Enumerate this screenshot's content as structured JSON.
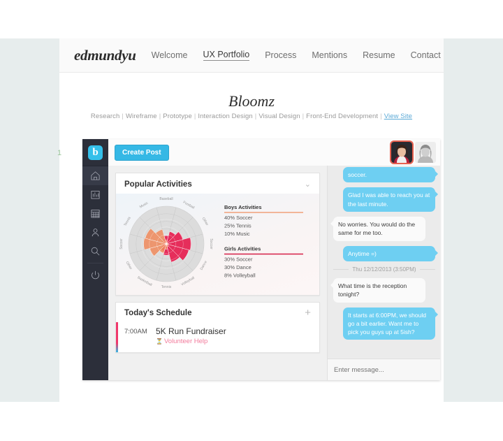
{
  "nav": {
    "logo": "edmundyu",
    "links": [
      {
        "label": "Welcome",
        "active": false
      },
      {
        "label": "UX Portfolio",
        "active": true
      },
      {
        "label": "Process",
        "active": false
      },
      {
        "label": "Mentions",
        "active": false
      },
      {
        "label": "Resume",
        "active": false
      },
      {
        "label": "Contact",
        "active": false
      }
    ]
  },
  "project": {
    "title": "Bloomz",
    "tags": [
      "Research",
      "Wireframe",
      "Prototype",
      "Interaction Design",
      "Visual Design",
      "Front-End Development"
    ],
    "link_label": "View Site",
    "marker": "1"
  },
  "app": {
    "brand_letter": "b",
    "sidebar_icons": [
      "home-icon",
      "bar-chart-icon",
      "calendar-icon",
      "person-icon",
      "search-icon",
      "power-icon"
    ],
    "topbar": {
      "create_post": "Create Post"
    },
    "activities_card": {
      "title": "Popular Activities",
      "collapse_icon": "chevron-down-icon"
    },
    "schedule_card": {
      "title": "Today's Schedule",
      "add_icon": "plus-icon",
      "events": [
        {
          "time": "7:00AM",
          "title": "5K Run Fundraiser",
          "sub": "Volunteer Help"
        }
      ]
    },
    "chat": {
      "messages": [
        {
          "from": "me",
          "text": "soccer.",
          "clipped": true
        },
        {
          "from": "me",
          "text": "Glad I was able to reach you at the last minute."
        },
        {
          "from": "them",
          "text": "No worries.  You would do the same for me too."
        },
        {
          "from": "me",
          "text": "Anytime =)"
        },
        {
          "from": "divider",
          "text": "Thu 12/12/2013 (3:50PM)"
        },
        {
          "from": "them",
          "text": "What time is the reception tonight?"
        },
        {
          "from": "me",
          "text": "It starts at 6:00PM, we should go a bit earlier.  Want me to pick you guys up at 5ish?"
        }
      ],
      "input_placeholder": "Enter message..."
    }
  },
  "chart_data": {
    "type": "pie",
    "title": "Popular Activities",
    "categories": [
      "Baseball",
      "Football",
      "Other",
      "Soccer",
      "Dance",
      "Volleyball",
      "Tennis",
      "Basketball",
      "Other",
      "Soccer",
      "Tennis",
      "Music"
    ],
    "series": [
      {
        "name": "Boys Activities",
        "color": "#f08a5d",
        "values": [
          10,
          6,
          4,
          5,
          6,
          8,
          14,
          26,
          46,
          60,
          58,
          40
        ]
      },
      {
        "name": "Girls Activities",
        "color": "#e8174a",
        "values": [
          22,
          34,
          46,
          66,
          62,
          50,
          30,
          20,
          12,
          9,
          8,
          14
        ]
      }
    ],
    "legend": [
      {
        "title": "Boys Activities",
        "color": "#f0a07a",
        "items": [
          "40% Soccer",
          "25% Tennis",
          "10% Music"
        ]
      },
      {
        "title": "Girls Activities",
        "color": "#d61f47",
        "items": [
          "30% Soccer",
          "30% Dance",
          "8% Volleyball"
        ]
      }
    ]
  }
}
